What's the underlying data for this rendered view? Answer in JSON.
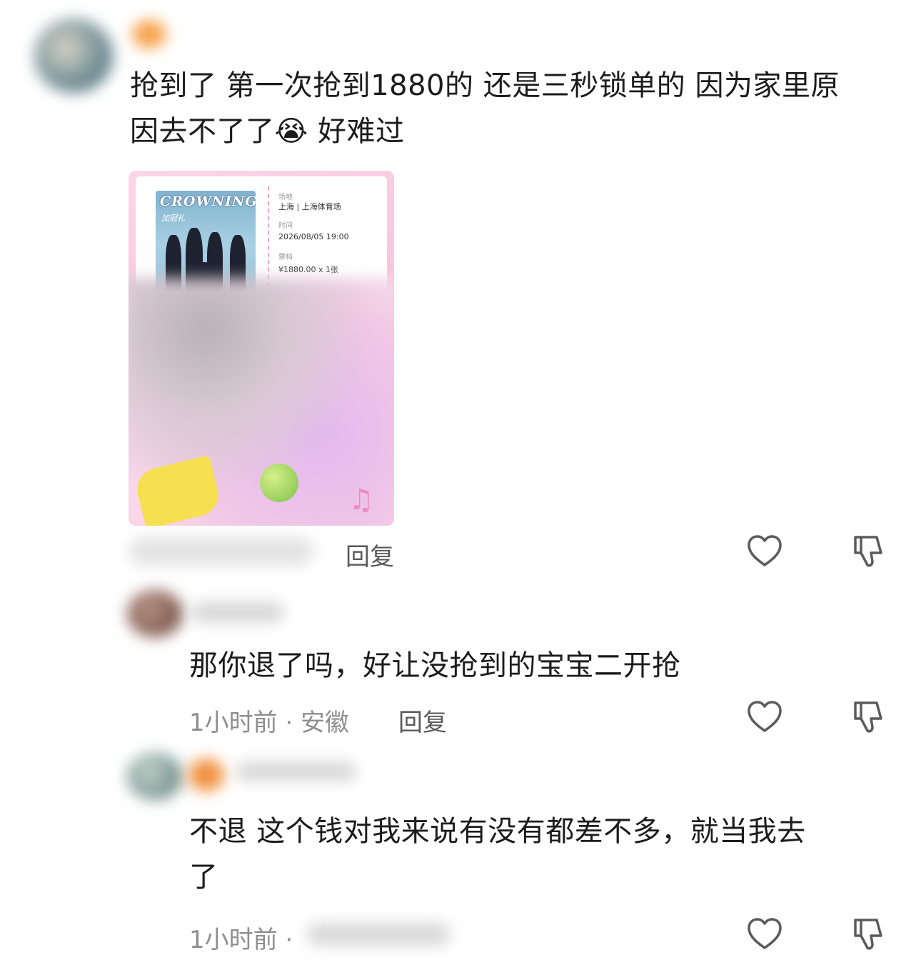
{
  "comments": [
    {
      "text_line1": "抢到了 第一次抢到1880的 还是三秒锁单的 因为家里原",
      "text_line2": "因去不了了😭 好难过",
      "reply_label": "回复",
      "ticket": {
        "poster_title": "CROWNING",
        "poster_subtitle": "加冠礼",
        "venue_label": "场地",
        "venue_value": "上海 | 上海体育场",
        "time_label": "时间",
        "time_value": "2026/08/05 19:00",
        "price_label": "票档",
        "price_value": "¥1880.00 x 1张"
      }
    },
    {
      "text": "那你退了吗，好让没抢到的宝宝二开抢",
      "meta": "1小时前 · 安徽",
      "reply_label": "回复"
    },
    {
      "text_line1": "不退 这个钱对我来说有没有都差不多，就当我去",
      "text_line2": "了",
      "meta": "1小时前 ·",
      "reply_label": "回复"
    }
  ],
  "icons": {
    "like": "heart-outline-icon",
    "dislike": "thumbs-down-outline-icon"
  },
  "colors": {
    "text": "#1c1c1c",
    "meta": "#8e8e8e",
    "ticket_pink": "#f9c4dd"
  }
}
